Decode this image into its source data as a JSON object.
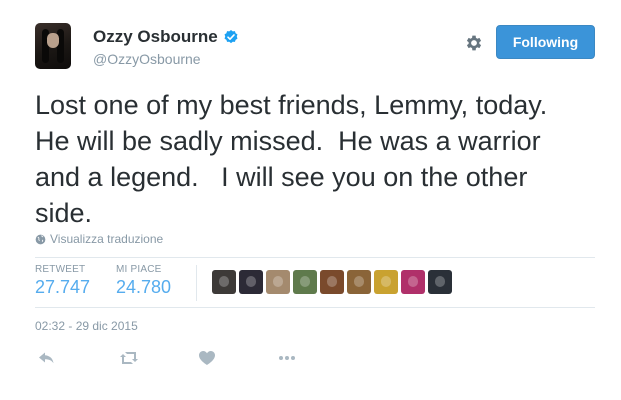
{
  "tweet": {
    "author": {
      "name": "Ozzy Osbourne",
      "handle": "@OzzyOsbourne",
      "verified": true
    },
    "follow_button_label": "Following",
    "text": "Lost one of my best friends, Lemmy, today.\nHe will be sadly missed.  He was a warrior\nand a legend.   I will see you on the other\nside.",
    "translate_label": "Visualizza traduzione",
    "stats": {
      "retweets_label": "RETWEET",
      "retweets_value": "27.747",
      "likes_label": "MI PIACE",
      "likes_value": "24.780"
    },
    "liker_avatar_colors": [
      "#3d3a38",
      "#2c2a36",
      "#a48a6e",
      "#5f7a4c",
      "#7a4a2c",
      "#8a6438",
      "#c9a230",
      "#b0306a",
      "#2a3038"
    ],
    "timestamp": "02:32 - 29 dic 2015"
  },
  "icons": {
    "gear": "gear-icon",
    "verified": "verified-badge-icon",
    "globe": "globe-icon",
    "reply": "reply-icon",
    "retweet": "retweet-icon",
    "like": "heart-icon",
    "more": "more-dots-icon"
  },
  "colors": {
    "accent": "#55acee",
    "follow_button": "#3b94d9",
    "muted_text": "#8899a6",
    "action_icon": "#aab8c2"
  }
}
